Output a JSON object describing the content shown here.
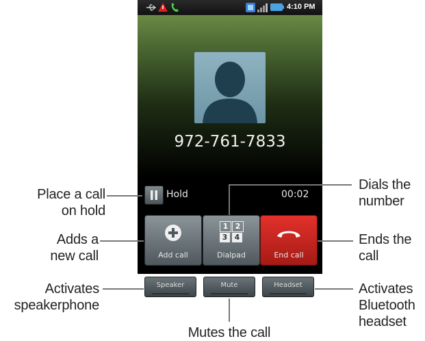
{
  "status_bar": {
    "time": "4:10 PM"
  },
  "call": {
    "phone_number": "972-761-7833",
    "hold_label": "Hold",
    "timer": "00:02"
  },
  "buttons": {
    "add_call": "Add call",
    "dialpad": "Dialpad",
    "dialpad_keys": [
      "1",
      "2",
      "3",
      "4"
    ],
    "end_call": "End call",
    "speaker": "Speaker",
    "mute": "Mute",
    "headset": "Headset"
  },
  "annotations": {
    "hold_line1": "Place a call",
    "hold_line2": "on hold",
    "add_line1": "Adds a",
    "add_line2": "new call",
    "speaker_line1": "Activates",
    "speaker_line2": "speakerphone",
    "dialpad_line1": "Dials the",
    "dialpad_line2": "number",
    "end_line1": "Ends the",
    "end_line2": "call",
    "headset_line1": "Activates",
    "headset_line2": "Bluetooth",
    "headset_line3": "headset",
    "mute_line": "Mutes the call"
  },
  "colors": {
    "end_call_red": "#d8231d",
    "call_bg_green": "#5c7c3c"
  }
}
